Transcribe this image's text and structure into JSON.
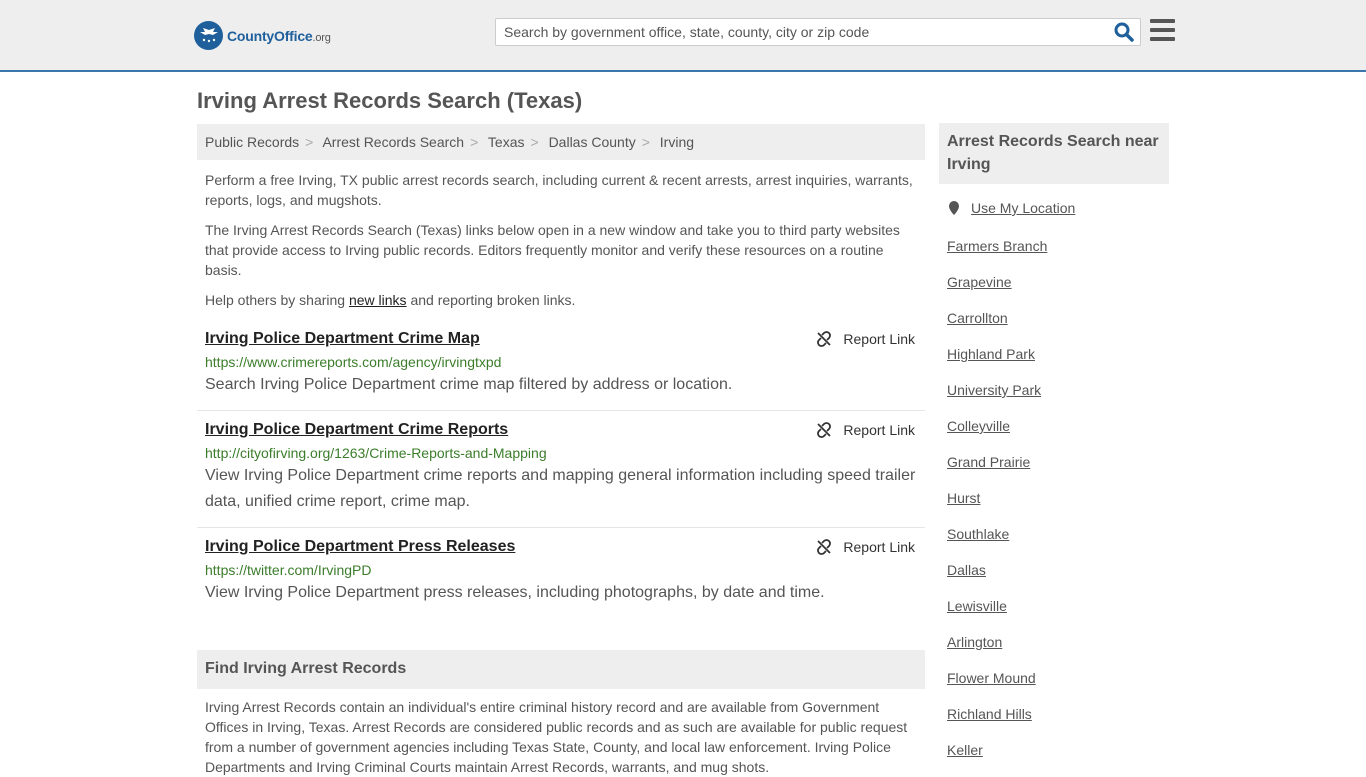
{
  "header": {
    "logo_text_main": "CountyOffice",
    "logo_text_tld": ".org",
    "search_placeholder": "Search by government office, state, county, city or zip code"
  },
  "page_title": "Irving Arrest Records Search (Texas)",
  "breadcrumb": [
    "Public Records",
    "Arrest Records Search",
    "Texas",
    "Dallas County",
    "Irving"
  ],
  "intro": {
    "p1": "Perform a free Irving, TX public arrest records search, including current & recent arrests, arrest inquiries, warrants, reports, logs, and mugshots.",
    "p2": "The Irving Arrest Records Search (Texas) links below open in a new window and take you to third party websites that provide access to Irving public records. Editors frequently monitor and verify these resources on a routine basis.",
    "p3_before": "Help others by sharing ",
    "p3_link": "new links",
    "p3_after": " and reporting broken links."
  },
  "report_label": "Report Link",
  "results": [
    {
      "title": "Irving Police Department Crime Map",
      "url": "https://www.crimereports.com/agency/irvingtxpd",
      "desc": "Search Irving Police Department crime map filtered by address or location."
    },
    {
      "title": "Irving Police Department Crime Reports",
      "url": "http://cityofirving.org/1263/Crime-Reports-and-Mapping",
      "desc": "View Irving Police Department crime reports and mapping general information including speed trailer data, unified crime report, crime map."
    },
    {
      "title": "Irving Police Department Press Releases",
      "url": "https://twitter.com/IrvingPD",
      "desc": "View Irving Police Department press releases, including photographs, by date and time."
    }
  ],
  "find_section": {
    "heading": "Find Irving Arrest Records",
    "text": "Irving Arrest Records contain an individual's entire criminal history record and are available from Government Offices in Irving, Texas. Arrest Records are considered public records and as such are available for public request from a number of government agencies including Texas State, County, and local law enforcement. Irving Police Departments and Irving Criminal Courts maintain Arrest Records, warrants, and mug shots."
  },
  "sidebar": {
    "heading": "Arrest Records Search near Irving",
    "use_location": "Use My Location",
    "cities": [
      "Farmers Branch",
      "Grapevine",
      "Carrollton",
      "Highland Park",
      "University Park",
      "Colleyville",
      "Grand Prairie",
      "Hurst",
      "Southlake",
      "Dallas",
      "Lewisville",
      "Arlington",
      "Flower Mound",
      "Richland Hills",
      "Keller"
    ]
  }
}
